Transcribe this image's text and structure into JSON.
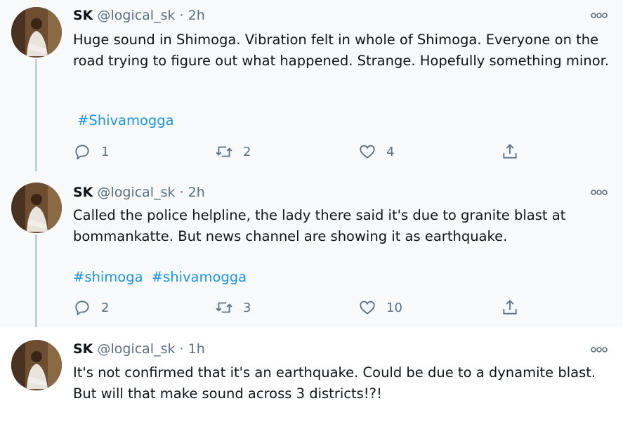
{
  "tweets": [
    {
      "name": "SK",
      "handle": "@logical_sk",
      "separator": "·",
      "time": "2h",
      "text": "Huge sound in Shimoga. Vibration felt in whole of Shimoga. Everyone on the road trying to figure out what happened. Strange. Hopefully something minor.",
      "hashtags": [
        "#Shivamogga"
      ],
      "replies": "1",
      "retweets": "2",
      "likes": "4"
    },
    {
      "name": "SK",
      "handle": "@logical_sk",
      "separator": "·",
      "time": "2h",
      "text": "Called the police helpline, the lady there said it's due to granite blast at bommankatte. But news channel are showing it as earthquake.",
      "hashtags": [
        "#shimoga",
        "#shivamogga"
      ],
      "replies": "2",
      "retweets": "3",
      "likes": "10"
    },
    {
      "name": "SK",
      "handle": "@logical_sk",
      "separator": "·",
      "time": "1h",
      "text": "It's not confirmed that it's an earthquake. Could be due to a dynamite blast. But will that make sound across 3 districts!?!"
    }
  ],
  "icons": {
    "more": "more-horizontal-icon",
    "reply": "reply-icon",
    "retweet": "retweet-icon",
    "like": "heart-icon",
    "share": "share-icon"
  },
  "colors": {
    "link": "#1b95e0",
    "muted": "#5b7083",
    "thread_line": "#c4cfd6",
    "highlight_bg": "#f7f9fa"
  }
}
